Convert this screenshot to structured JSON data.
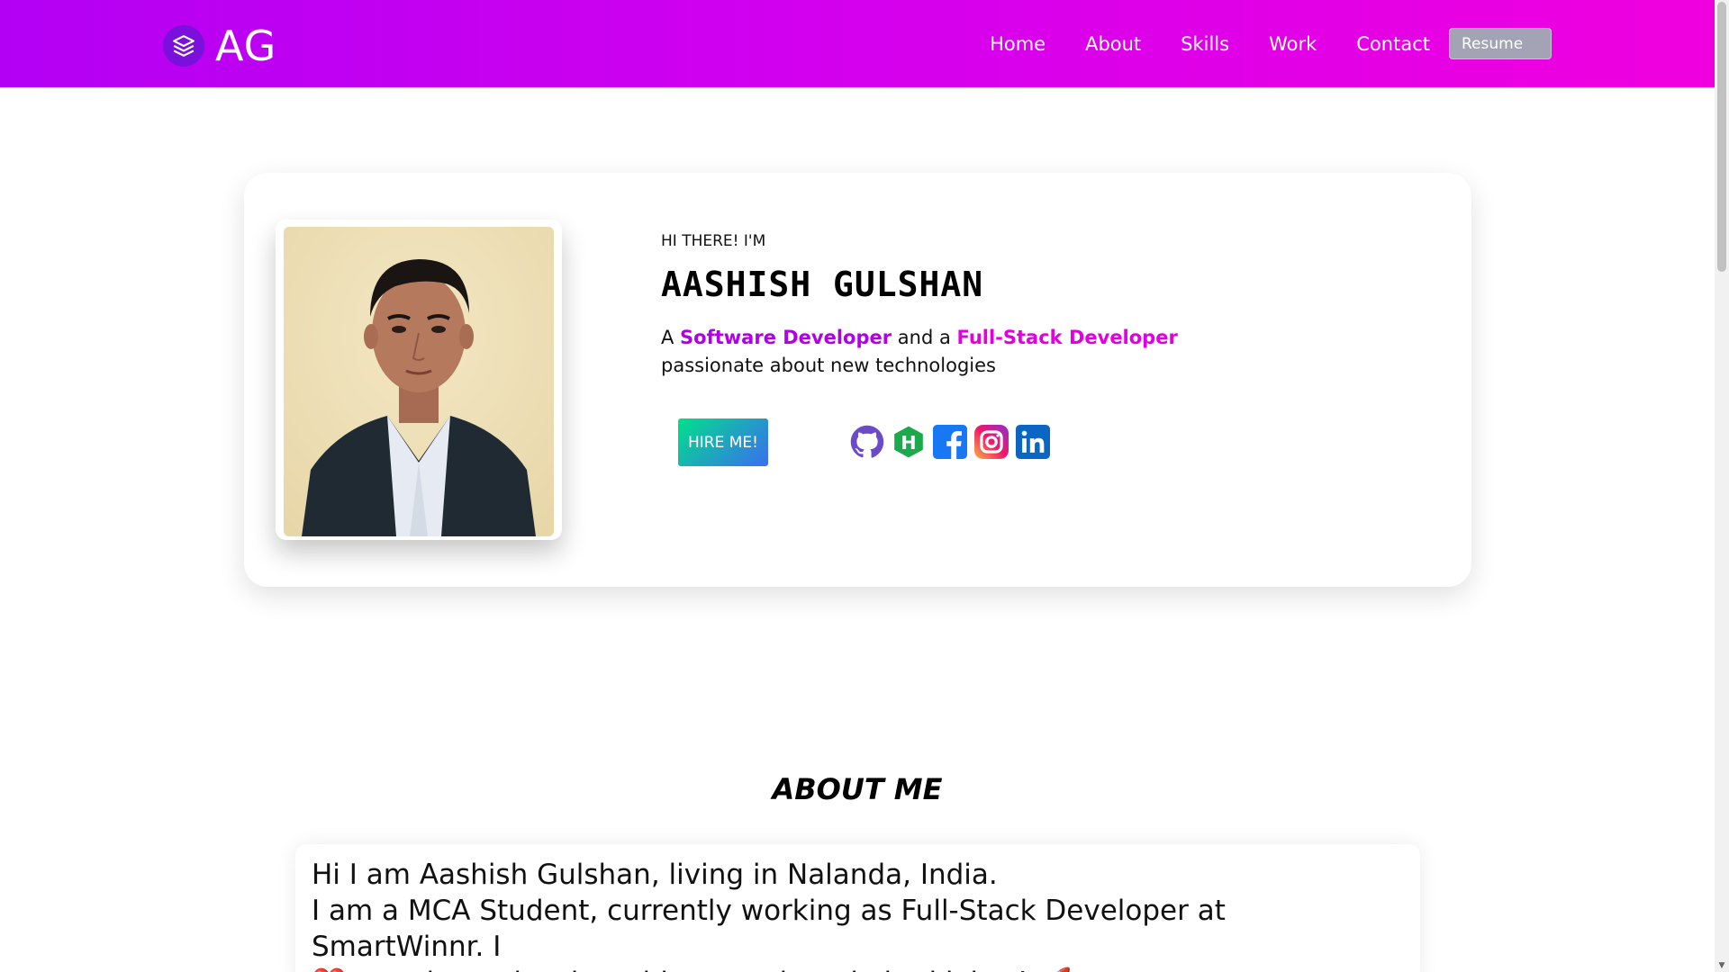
{
  "nav": {
    "logo_text": "AG",
    "logo_icon": "layers-icon",
    "links": [
      "Home",
      "About",
      "Skills",
      "Work",
      "Contact"
    ],
    "resume_label": "Resume"
  },
  "hero": {
    "greeting": "HI THERE! I'M",
    "name": "AASHISH GULSHAN",
    "tagline_prefix": "A ",
    "role1": "Software Developer",
    "tagline_mid": " and a ",
    "role2": "Full-Stack Developer",
    "tagline_suffix": "passionate about new technologies",
    "hire_label": "HIRE ME!",
    "socials": [
      "github-icon",
      "hackerrank-icon",
      "facebook-icon",
      "instagram-icon",
      "linkedin-icon"
    ]
  },
  "about": {
    "title": "ABOUT ME",
    "line1": "Hi I am Aashish Gulshan, living in Nalanda, India.",
    "line2": "I am a MCA Student, currently working as Full-Stack Developer at SmartWinnr. I",
    "line3": "❤️ to write code, share ideas, and made bad jokes! 🚀"
  },
  "colors": {
    "nav_gradient_start": "#b300f4",
    "nav_gradient_end": "#f000de",
    "role1": "#b100e8",
    "role2": "#e000e0",
    "hire_gradient_start": "#00e08a",
    "hire_gradient_end": "#3b6df0"
  }
}
